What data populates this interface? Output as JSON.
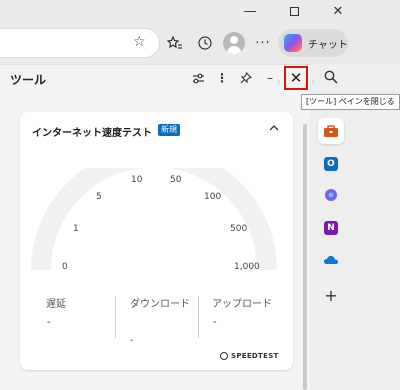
{
  "copilot": {
    "label": "チャット"
  },
  "pane": {
    "title": "ツール",
    "tooltip": "[ツール] ペインを閉じる"
  },
  "card": {
    "title": "インターネット速度テスト",
    "badge": "新規",
    "gauge_ticks": [
      "0",
      "1",
      "5",
      "10",
      "50",
      "100",
      "500",
      "1,000"
    ],
    "metrics": [
      {
        "label": "遅延",
        "value": "-"
      },
      {
        "label": "ダウンロード",
        "value": "-"
      },
      {
        "label": "アップロード",
        "value": "-"
      }
    ],
    "brand": "SPEEDTEST"
  },
  "sidebar": {
    "items": [
      {
        "icon": "toolbox-icon",
        "color": "#d4571c"
      },
      {
        "icon": "outlook-icon",
        "color": "#0f6cbd",
        "glyph": "O"
      },
      {
        "icon": "copilot-icon",
        "color": "#7b5cf5"
      },
      {
        "icon": "onenote-icon",
        "color": "#7719aa",
        "glyph": "N"
      },
      {
        "icon": "onedrive-icon",
        "color": "#0f78d4"
      },
      {
        "icon": "add-icon",
        "glyph": "+"
      }
    ]
  },
  "colors": {
    "close_highlight": "#e01010",
    "badge_blue": "#0f6cbd",
    "gauge_track": "#f1f1f1"
  }
}
